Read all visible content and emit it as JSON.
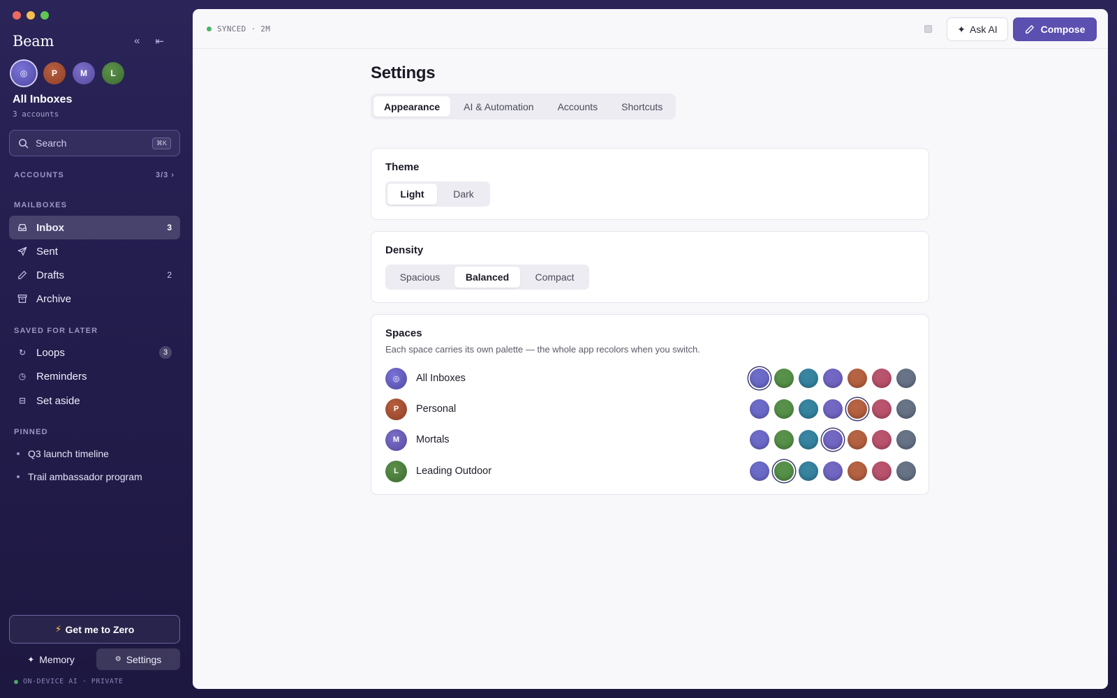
{
  "app": {
    "brand": "Beam"
  },
  "colors": {
    "accent": "#5b4fb0",
    "palette": [
      "#6463c4",
      "#4e8a40",
      "#2d7d9a",
      "#6a5fbe",
      "#b05a38",
      "#b54a66",
      "#5f6b80"
    ]
  },
  "sidebar": {
    "collapse_icon": "double-chevron-left-icon",
    "dock_icon": "arrow-to-left-icon",
    "current_space": {
      "title": "All Inboxes",
      "subtitle": "3 accounts"
    },
    "avatars": [
      {
        "letter": "◎",
        "name": "all-inboxes"
      },
      {
        "letter": "P",
        "name": "personal"
      },
      {
        "letter": "M",
        "name": "mortals"
      },
      {
        "letter": "L",
        "name": "leading-outdoor"
      }
    ],
    "search": {
      "placeholder": "Search",
      "shortcut": "⌘K"
    },
    "accounts": {
      "label": "ACCOUNTS",
      "count": "3/3 ›"
    },
    "mailboxes_label": "MAILBOXES",
    "mailboxes": [
      {
        "label": "Inbox",
        "count": "3",
        "icon": "inbox-icon"
      },
      {
        "label": "Sent",
        "count": "",
        "icon": "send-icon"
      },
      {
        "label": "Drafts",
        "count": "2",
        "icon": "pencil-icon"
      },
      {
        "label": "Archive",
        "count": "",
        "icon": "archive-icon"
      }
    ],
    "saved_label": "SAVED FOR LATER",
    "saved": [
      {
        "label": "Loops",
        "count": "3",
        "glyph": "↻"
      },
      {
        "label": "Reminders",
        "count": "",
        "glyph": "◷"
      },
      {
        "label": "Set aside",
        "count": "",
        "glyph": "⊟"
      }
    ],
    "pinned_label": "PINNED",
    "pinned": [
      "Q3 launch timeline",
      "Trail ambassador program"
    ],
    "zero_button": "Get me to Zero",
    "memory_button": "Memory",
    "settings_button": "Settings",
    "footer_note": "ON-DEVICE AI · PRIVATE"
  },
  "topbar": {
    "sync_status": "SYNCED · 2M",
    "ask_ai": "Ask AI",
    "compose": "Compose"
  },
  "settings": {
    "title": "Settings",
    "tabs": [
      "Appearance",
      "AI & Automation",
      "Accounts",
      "Shortcuts"
    ],
    "active_tab": "Appearance",
    "theme": {
      "title": "Theme",
      "options": [
        "Light",
        "Dark"
      ],
      "selected": "Light"
    },
    "density": {
      "title": "Density",
      "options": [
        "Spacious",
        "Balanced",
        "Compact"
      ],
      "selected": "Balanced"
    },
    "spaces": {
      "title": "Spaces",
      "description": "Each space carries its own palette — the whole app recolors when you switch.",
      "rows": [
        {
          "name": "All Inboxes",
          "letter": "◎",
          "selected_swatch": 0
        },
        {
          "name": "Personal",
          "letter": "P",
          "selected_swatch": 4
        },
        {
          "name": "Mortals",
          "letter": "M",
          "selected_swatch": 3
        },
        {
          "name": "Leading Outdoor",
          "letter": "L",
          "selected_swatch": 1
        }
      ]
    }
  }
}
